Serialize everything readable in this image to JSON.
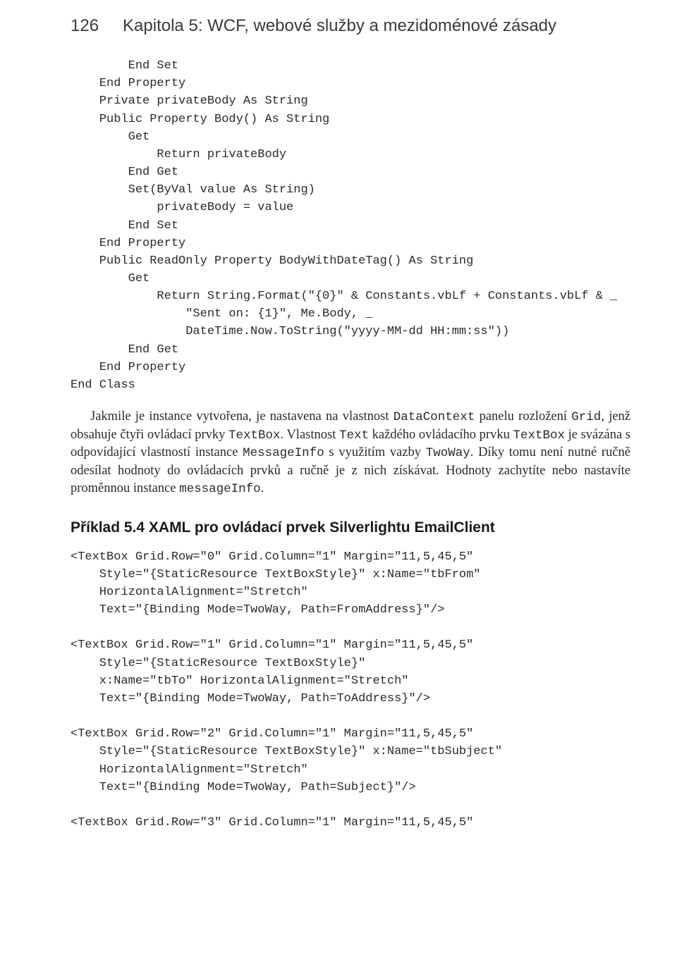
{
  "header": {
    "page_number": "126",
    "chapter_title": "Kapitola 5: WCF, webové služby a mezidoménové zásady"
  },
  "code_block_1": "        End Set\n    End Property\n    Private privateBody As String\n    Public Property Body() As String\n        Get\n            Return privateBody\n        End Get\n        Set(ByVal value As String)\n            privateBody = value\n        End Set\n    End Property\n    Public ReadOnly Property BodyWithDateTag() As String\n        Get\n            Return String.Format(\"{0}\" & Constants.vbLf + Constants.vbLf & _\n                \"Sent on: {1}\", Me.Body, _\n                DateTime.Now.ToString(\"yyyy-MM-dd HH:mm:ss\"))\n        End Get\n    End Property\nEnd Class",
  "paragraph_1_a": "Jakmile je instance vytvořena, je nastavena na vlastnost ",
  "paragraph_1_b": " panelu rozložení ",
  "paragraph_1_c": ", jenž obsahuje čtyři ovládací prvky ",
  "paragraph_1_d": ". Vlastnost ",
  "paragraph_1_e": " každého ovládacího prvku ",
  "paragraph_1_f": " je svázána s odpovídající vlastností instance ",
  "paragraph_1_g": " s využitím vazby ",
  "paragraph_1_h": ". Díky tomu není nutné ručně odesílat hodnoty do ovládacích prvků a ručně je z nich získávat. Hodnoty zachytíte nebo nastavíte proměnnou instance ",
  "paragraph_1_i": ".",
  "mono": {
    "DataContext": "DataContext",
    "Grid": "Grid",
    "TextBox": "TextBox",
    "Text": "Text",
    "MessageInfo": "MessageInfo",
    "TwoWay": "TwoWay",
    "messageInfo": "messageInfo"
  },
  "example_heading": "Příklad 5.4 XAML pro ovládací prvek Silverlightu EmailClient",
  "code_block_2": "<TextBox Grid.Row=\"0\" Grid.Column=\"1\" Margin=\"11,5,45,5\"\n    Style=\"{StaticResource TextBoxStyle}\" x:Name=\"tbFrom\"\n    HorizontalAlignment=\"Stretch\"\n    Text=\"{Binding Mode=TwoWay, Path=FromAddress}\"/>\n\n<TextBox Grid.Row=\"1\" Grid.Column=\"1\" Margin=\"11,5,45,5\"\n    Style=\"{StaticResource TextBoxStyle}\"\n    x:Name=\"tbTo\" HorizontalAlignment=\"Stretch\"\n    Text=\"{Binding Mode=TwoWay, Path=ToAddress}\"/>\n\n<TextBox Grid.Row=\"2\" Grid.Column=\"1\" Margin=\"11,5,45,5\"\n    Style=\"{StaticResource TextBoxStyle}\" x:Name=\"tbSubject\"\n    HorizontalAlignment=\"Stretch\"\n    Text=\"{Binding Mode=TwoWay, Path=Subject}\"/>\n\n<TextBox Grid.Row=\"3\" Grid.Column=\"1\" Margin=\"11,5,45,5\""
}
